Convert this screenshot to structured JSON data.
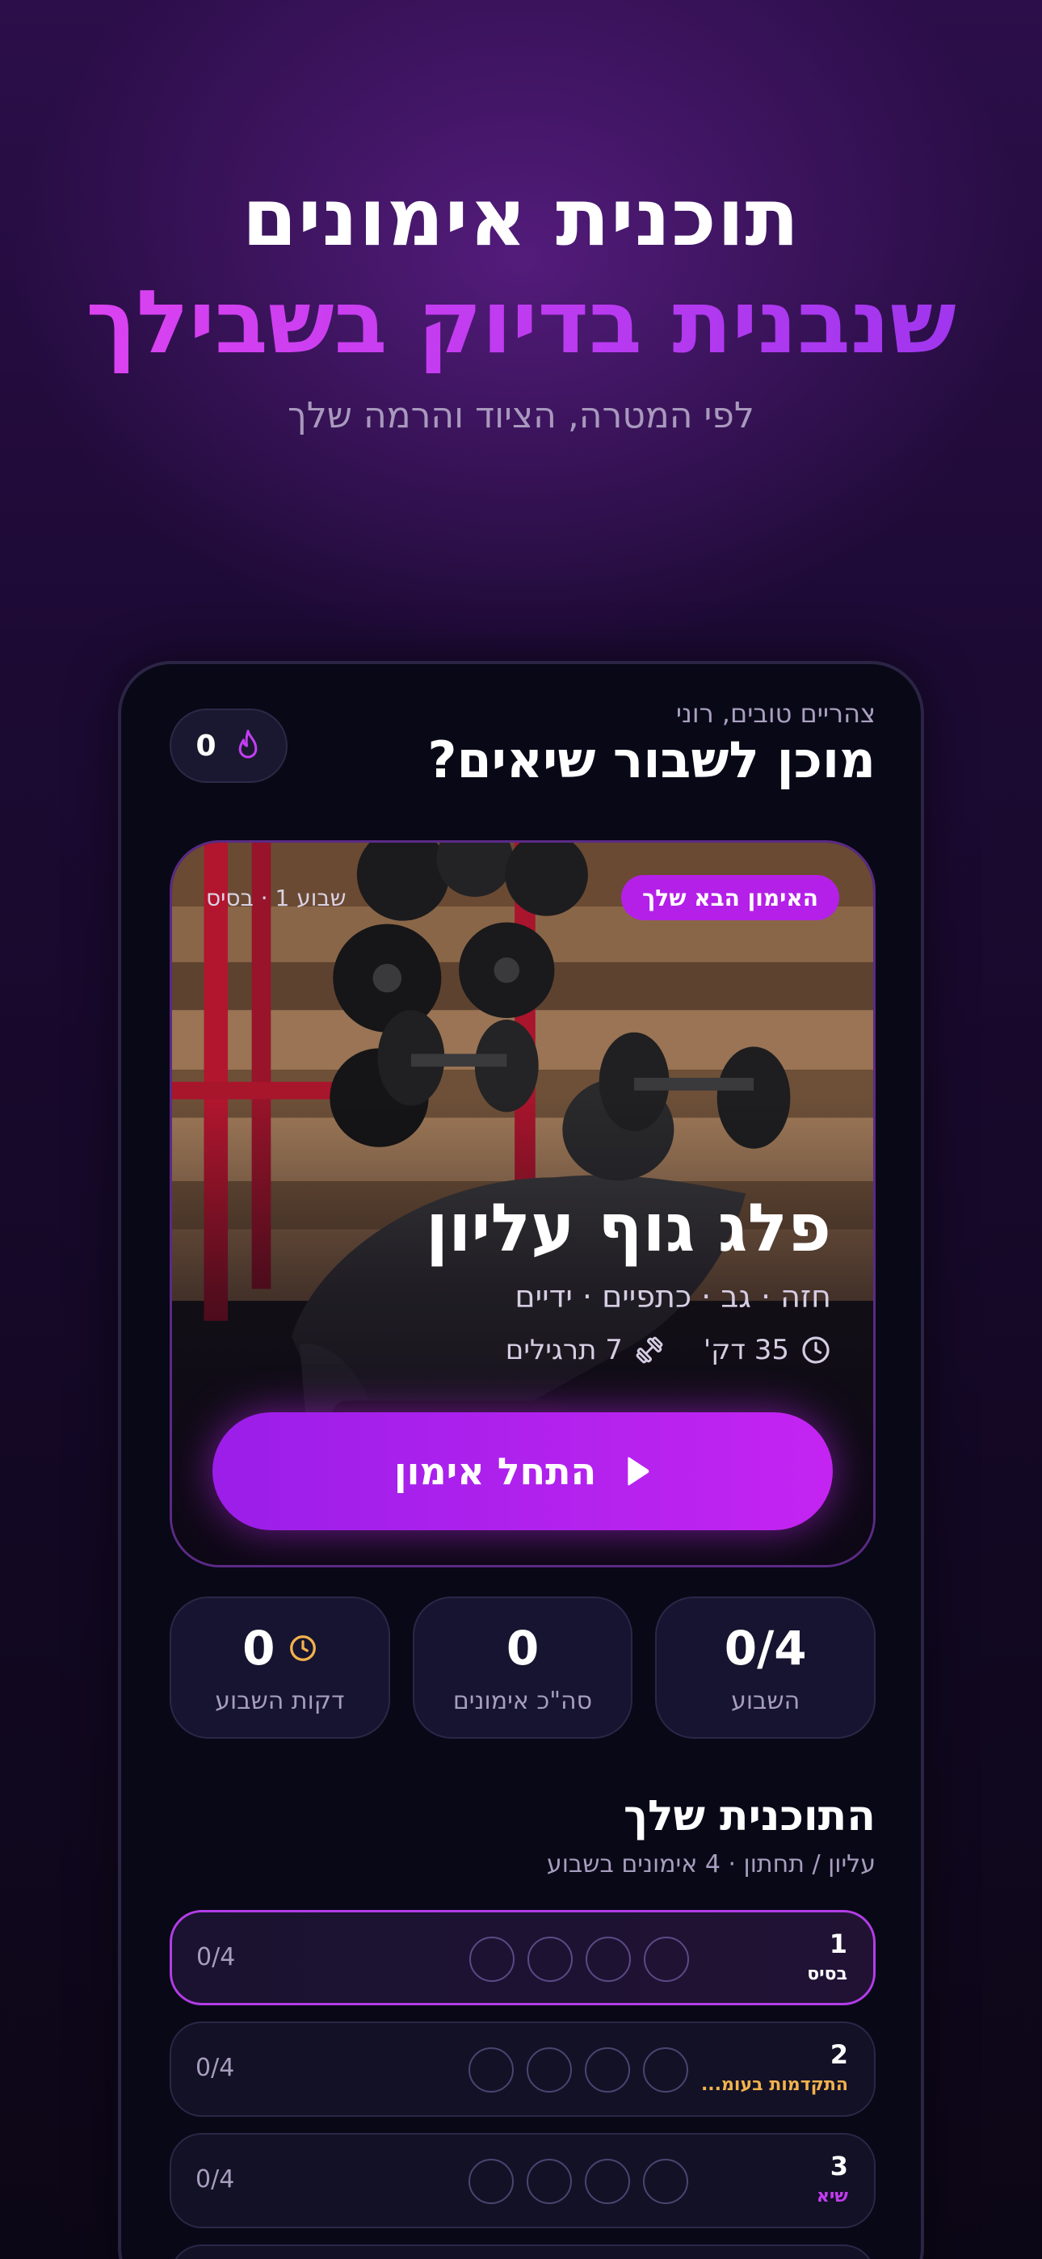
{
  "hero": {
    "title_line1": "תוכנית אימונים",
    "title_line2": "שנבנית בדיוק בשבילך",
    "subtitle": "לפי המטרה, הציוד והרמה שלך"
  },
  "app": {
    "greeting": "צהריים טובים, רוני",
    "headline": "מוכן לשבור שיאים?",
    "streak_value": "0",
    "next_workout": {
      "badge": "האימון הבא שלך",
      "week_label": "שבוע 1 · בסיס",
      "title": "פלג גוף עליון",
      "muscles": "חזה · גב · כתפיים · ידיים",
      "duration": "35 דק'",
      "exercises": "7 תרגילים",
      "start_button": "התחל אימון"
    },
    "stats": [
      {
        "value": "0/4",
        "label": "השבוע"
      },
      {
        "value": "0",
        "label": "סה\"כ אימונים"
      },
      {
        "value": "0",
        "label": "דקות השבוע"
      }
    ],
    "plan": {
      "title": "התוכנית שלך",
      "subtitle": "עליון / תחתון · 4 אימונים בשבוע",
      "weeks": [
        {
          "number": "1",
          "label": "בסיס",
          "count": "0/4",
          "label_color": "#ffffff"
        },
        {
          "number": "2",
          "label": "התקדמות בעומ...",
          "count": "0/4",
          "label_color": "#f2b24c"
        },
        {
          "number": "3",
          "label": "שיא",
          "count": "0/4",
          "label_color": "#c23cf0"
        }
      ]
    }
  },
  "colors": {
    "accent": "#b420e8",
    "background": "#090817",
    "card": "#161430"
  }
}
